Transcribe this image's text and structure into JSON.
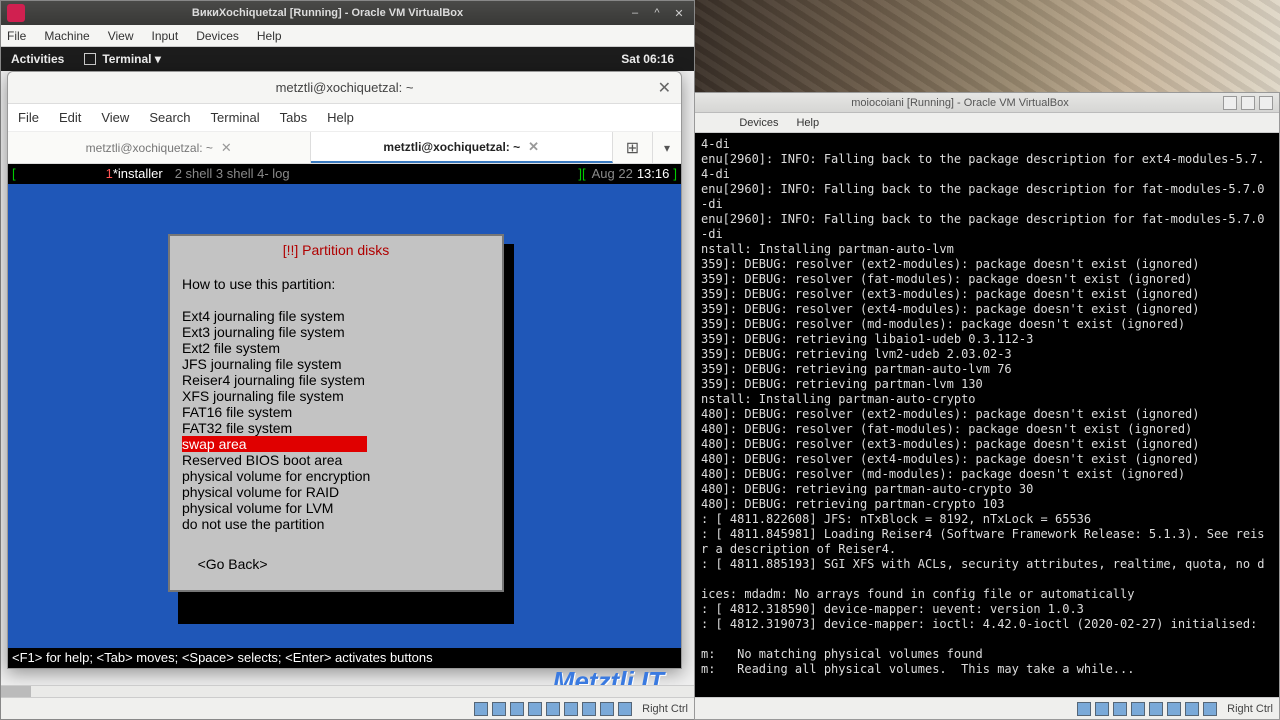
{
  "left_vbox": {
    "title": "ВикиXochiquetzal [Running] - Oracle VM VirtualBox",
    "menu": [
      "File",
      "Machine",
      "View",
      "Input",
      "Devices",
      "Help"
    ],
    "window_buttons": {
      "min": "–",
      "max": "^",
      "close": "✕"
    },
    "status_key": "Right Ctrl"
  },
  "gnome": {
    "activities": "Activities",
    "terminal_indicator": "Terminal ▾",
    "clock": "Sat 06:16"
  },
  "gterm": {
    "title": "metztli@xochiquetzal: ~",
    "close": "✕",
    "menu": [
      "File",
      "Edit",
      "View",
      "Search",
      "Terminal",
      "Tabs",
      "Help"
    ],
    "tabs": [
      {
        "label": "metztli@xochiquetzal: ~",
        "close": "✕"
      },
      {
        "label": "metztli@xochiquetzal: ~",
        "close": "✕"
      }
    ],
    "newtab": "⊞",
    "dropdown": "▾"
  },
  "status_top": {
    "left_bracket": "[",
    "one": "1",
    "star": "*installer",
    "items": "  2 shell  3 shell  4- log",
    "right_bracket": "][",
    "date": "Aug 22",
    "time": "13:16",
    "end": "]"
  },
  "dialog": {
    "title": "[!!] Partition disks",
    "prompt": "How to use this partition:",
    "options": [
      "Ext4 journaling file system",
      "Ext3 journaling file system",
      "Ext2 file system",
      "JFS journaling file system",
      "Reiser4 journaling file system",
      "XFS journaling file system",
      "FAT16 file system",
      "FAT32 file system",
      "swap area",
      "Reserved BIOS boot area",
      "physical volume for encryption",
      "physical volume for RAID",
      "physical volume for LVM",
      "do not use the partition"
    ],
    "selected_index": 8,
    "go_back": "<Go Back>"
  },
  "helpline": "<F1> for help; <Tab> moves; <Space> selects; <Enter> activates buttons",
  "watermark": "Metztli IT",
  "right_vbox": {
    "title": "moiocoiani [Running] - Oracle VM VirtualBox",
    "menu_visible": [
      "Devices",
      "Help"
    ],
    "status_key": "Right Ctrl",
    "log": [
      "4-di",
      "enu[2960]: INFO: Falling back to the package description for ext4-modules-5.7.",
      "4-di",
      "enu[2960]: INFO: Falling back to the package description for fat-modules-5.7.0",
      "-di",
      "enu[2960]: INFO: Falling back to the package description for fat-modules-5.7.0",
      "-di",
      "nstall: Installing partman-auto-lvm",
      "359]: DEBUG: resolver (ext2-modules): package doesn't exist (ignored)",
      "359]: DEBUG: resolver (fat-modules): package doesn't exist (ignored)",
      "359]: DEBUG: resolver (ext3-modules): package doesn't exist (ignored)",
      "359]: DEBUG: resolver (ext4-modules): package doesn't exist (ignored)",
      "359]: DEBUG: resolver (md-modules): package doesn't exist (ignored)",
      "359]: DEBUG: retrieving libaio1-udeb 0.3.112-3",
      "359]: DEBUG: retrieving lvm2-udeb 2.03.02-3",
      "359]: DEBUG: retrieving partman-auto-lvm 76",
      "359]: DEBUG: retrieving partman-lvm 130",
      "nstall: Installing partman-auto-crypto",
      "480]: DEBUG: resolver (ext2-modules): package doesn't exist (ignored)",
      "480]: DEBUG: resolver (fat-modules): package doesn't exist (ignored)",
      "480]: DEBUG: resolver (ext3-modules): package doesn't exist (ignored)",
      "480]: DEBUG: resolver (ext4-modules): package doesn't exist (ignored)",
      "480]: DEBUG: resolver (md-modules): package doesn't exist (ignored)",
      "480]: DEBUG: retrieving partman-auto-crypto 30",
      "480]: DEBUG: retrieving partman-crypto 103",
      ": [ 4811.822608] JFS: nTxBlock = 8192, nTxLock = 65536",
      ": [ 4811.845981] Loading Reiser4 (Software Framework Release: 5.1.3). See reis",
      "r a description of Reiser4.",
      ": [ 4811.885193] SGI XFS with ACLs, security attributes, realtime, quota, no d",
      "",
      "ices: mdadm: No arrays found in config file or automatically",
      ": [ 4812.318590] device-mapper: uevent: version 1.0.3",
      ": [ 4812.319073] device-mapper: ioctl: 4.42.0-ioctl (2020-02-27) initialised:",
      "",
      "m:   No matching physical volumes found",
      "m:   Reading all physical volumes.  This may take a while..."
    ]
  }
}
